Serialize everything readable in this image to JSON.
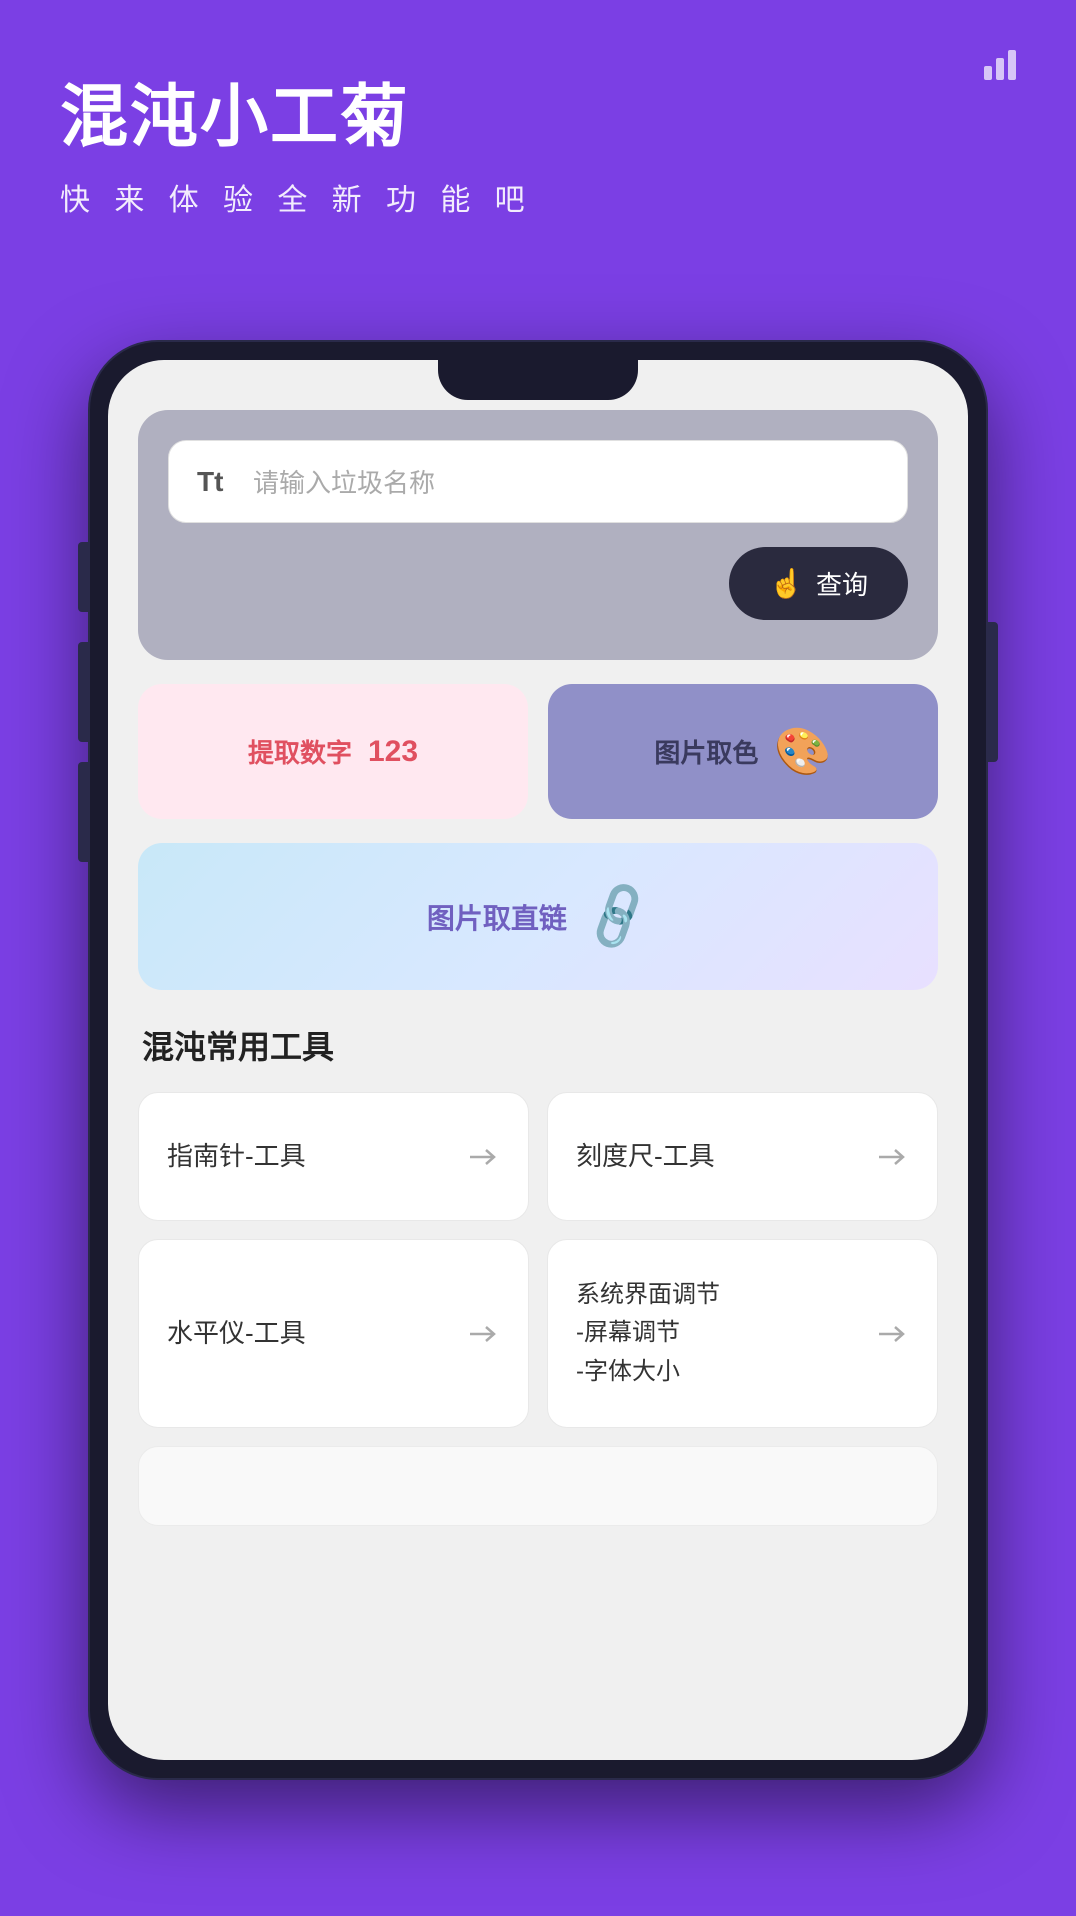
{
  "header": {
    "title": "混沌小工菊",
    "subtitle": "快 来 体 验 全 新 功 能 吧",
    "signal_alt": "signal-bars"
  },
  "phone": {
    "search_section": {
      "placeholder": "请输入垃圾名称",
      "tt_label": "Tt",
      "query_button": "查询",
      "finger_icon": "☝"
    },
    "feature_cards": {
      "extract_number": {
        "label": "提取数字",
        "icon": "123"
      },
      "color_pick": {
        "label": "图片取色",
        "icon": "🎨"
      },
      "image_link": {
        "label": "图片取直链",
        "icon": "🔗"
      }
    },
    "tools_section": {
      "title": "混沌常用工具",
      "tools": [
        {
          "name": "指南针-工具",
          "arrow": "→"
        },
        {
          "name": "刻度尺-工具",
          "arrow": "→"
        },
        {
          "name": "水平仪-工具",
          "arrow": "→"
        },
        {
          "name": "系统界面调节\n-屏幕调节\n-字体大小",
          "arrow": "→"
        }
      ]
    }
  },
  "colors": {
    "purple_bg": "#7B3FE4",
    "dark_phone": "#1a1a2e",
    "search_bg": "#b0b0c0",
    "extract_bg": "#ffe8f0",
    "color_pick_bg": "#9090c8",
    "image_link_gradient_start": "#c8e8f8",
    "image_link_gradient_end": "#e8e0ff"
  }
}
